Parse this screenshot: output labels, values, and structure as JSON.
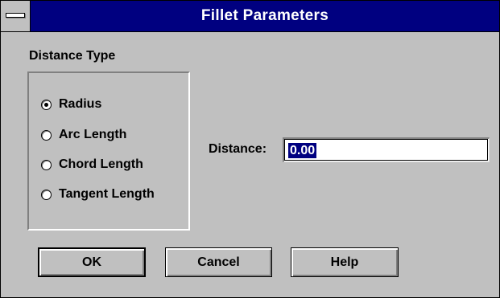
{
  "window": {
    "title": "Fillet Parameters"
  },
  "distance_type": {
    "group_label": "Distance Type",
    "options": [
      {
        "label": "Radius",
        "selected": true
      },
      {
        "label": "Arc Length",
        "selected": false
      },
      {
        "label": "Chord Length",
        "selected": false
      },
      {
        "label": "Tangent Length",
        "selected": false
      }
    ]
  },
  "distance": {
    "label": "Distance:",
    "value": "0.00"
  },
  "buttons": {
    "ok": "OK",
    "cancel": "Cancel",
    "help": "Help"
  },
  "colors": {
    "titlebar": "#000080",
    "dialog": "#c0c0c0"
  }
}
